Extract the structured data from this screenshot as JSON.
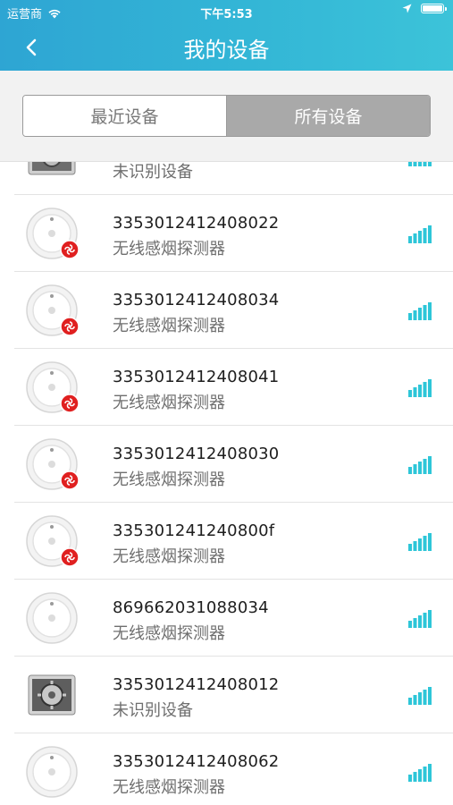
{
  "status_bar": {
    "carrier": "运营商",
    "time": "下午5:53"
  },
  "nav": {
    "title": "我的设备"
  },
  "segments": {
    "recent": "最近设备",
    "all": "所有设备",
    "selected": "all"
  },
  "devices": [
    {
      "id": "",
      "type": "未识别设备",
      "icon": "gear-device-icon",
      "offline_badge": false,
      "partial": true
    },
    {
      "id": "3353012412408022",
      "type": "无线感烟探测器",
      "icon": "smoke-detector-icon",
      "offline_badge": true
    },
    {
      "id": "3353012412408034",
      "type": "无线感烟探测器",
      "icon": "smoke-detector-icon",
      "offline_badge": true
    },
    {
      "id": "3353012412408041",
      "type": "无线感烟探测器",
      "icon": "smoke-detector-icon",
      "offline_badge": true
    },
    {
      "id": "3353012412408030",
      "type": "无线感烟探测器",
      "icon": "smoke-detector-icon",
      "offline_badge": true
    },
    {
      "id": "335301241240800f",
      "type": "无线感烟探测器",
      "icon": "smoke-detector-icon",
      "offline_badge": true
    },
    {
      "id": "869662031088034",
      "type": "无线感烟探测器",
      "icon": "smoke-detector-icon",
      "offline_badge": false
    },
    {
      "id": "3353012412408012",
      "type": "未识别设备",
      "icon": "gear-device-icon",
      "offline_badge": false
    },
    {
      "id": "3353012412408062",
      "type": "无线感烟探测器",
      "icon": "smoke-detector-icon",
      "offline_badge": false
    }
  ],
  "colors": {
    "header": "#33b6d6",
    "signal": "#2ec6d8",
    "badge": "#e02020"
  }
}
